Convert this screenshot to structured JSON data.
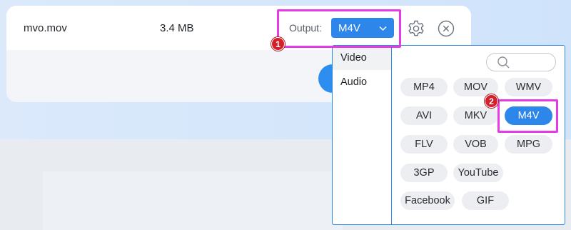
{
  "file": {
    "name": "mvo.mov",
    "size": "3.4 MB"
  },
  "output": {
    "label": "Output:",
    "value": "M4V"
  },
  "icons": {
    "settings": "gear-icon",
    "remove": "close-icon",
    "search": "search-icon",
    "caret": "chevron-down-icon"
  },
  "badges": [
    "1",
    "2"
  ],
  "dropdown": {
    "categories": [
      {
        "label": "Video",
        "active": true
      },
      {
        "label": "Audio",
        "active": false
      }
    ],
    "formats": [
      "MP4",
      "MOV",
      "WMV",
      "AVI",
      "MKV",
      "M4V",
      "FLV",
      "VOB",
      "MPG",
      "3GP",
      "YouTube",
      "Facebook",
      "GIF"
    ],
    "selected": "M4V"
  },
  "colors": {
    "accent": "#2d86e9",
    "highlight": "#e53be6",
    "badge": "#d3202a"
  }
}
